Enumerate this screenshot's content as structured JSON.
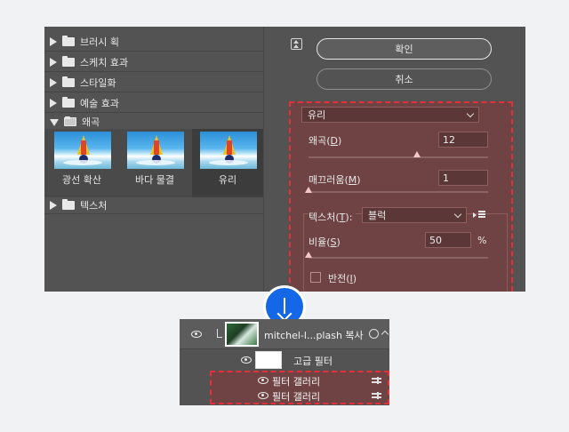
{
  "gallery": {
    "categories": [
      {
        "label": "브러시 획",
        "expanded": false
      },
      {
        "label": "스케치 효과",
        "expanded": false
      },
      {
        "label": "스타일화",
        "expanded": false
      },
      {
        "label": "예술 효과",
        "expanded": false
      },
      {
        "label": "왜곡",
        "expanded": true
      },
      {
        "label": "텍스처",
        "expanded": false
      }
    ],
    "thumbnails": [
      {
        "label": "광선 확산"
      },
      {
        "label": "바다 물결"
      },
      {
        "label": "유리",
        "selected": true
      }
    ],
    "buttons": {
      "ok": "확인",
      "cancel": "취소"
    },
    "settings": {
      "filter": "유리",
      "distortion": {
        "label": "왜곡",
        "key": "D",
        "value": "12",
        "level_pct": 60
      },
      "smoothness": {
        "label": "매끄러움",
        "key": "M",
        "value": "1",
        "level_pct": 0
      },
      "texture": {
        "label": "텍스처",
        "key": "T",
        "value": "블럭"
      },
      "scaling": {
        "label": "비율",
        "key": "S",
        "value": "50",
        "unit": "%",
        "level_pct": 0
      },
      "invert": {
        "label": "반전",
        "key": "I",
        "checked": false
      }
    },
    "colors": {
      "highlight": "#e3313a",
      "panel": "#535353"
    }
  },
  "layers": {
    "layer_name": "mitchel-l...plash 복사",
    "smart_filters_label": "고급 필터",
    "filters": [
      "필터 갤러리",
      "필터 갤러리"
    ]
  }
}
